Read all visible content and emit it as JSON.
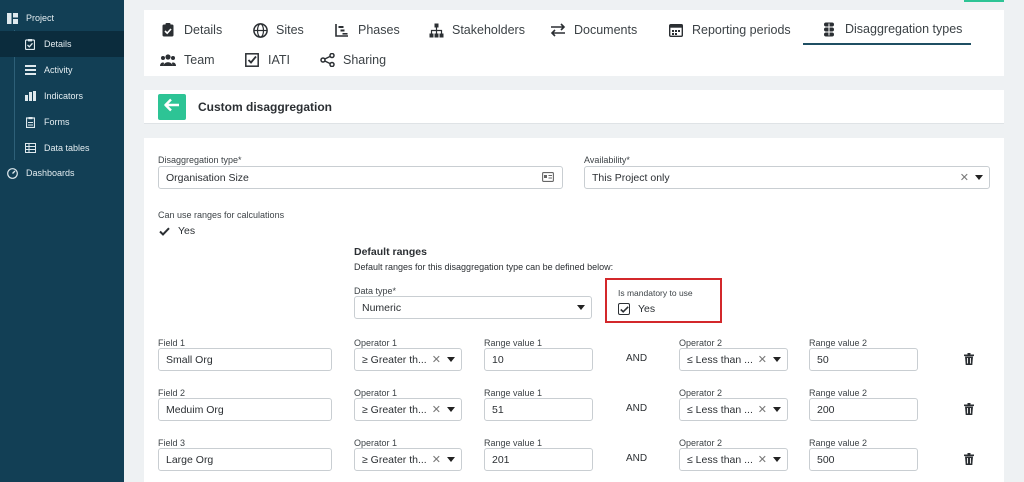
{
  "sidebar": {
    "items": [
      {
        "label": "Project",
        "icon": "project-icon",
        "level": "top",
        "active": false
      },
      {
        "label": "Details",
        "icon": "clipboard-icon",
        "level": "sub",
        "active": true
      },
      {
        "label": "Activity",
        "icon": "list-icon",
        "level": "sub",
        "active": false
      },
      {
        "label": "Indicators",
        "icon": "bar-chart-icon",
        "level": "sub",
        "active": false
      },
      {
        "label": "Forms",
        "icon": "form-icon",
        "level": "sub",
        "active": false
      },
      {
        "label": "Data tables",
        "icon": "table-icon",
        "level": "sub",
        "active": false
      },
      {
        "label": "Dashboards",
        "icon": "gauge-icon",
        "level": "top",
        "active": false
      }
    ]
  },
  "tabs": [
    {
      "label": "Details",
      "icon": "clipboard-icon",
      "active": false
    },
    {
      "label": "Sites",
      "icon": "globe-icon",
      "active": false
    },
    {
      "label": "Phases",
      "icon": "chart-icon",
      "active": false
    },
    {
      "label": "Stakeholders",
      "icon": "hierarchy-icon",
      "active": false
    },
    {
      "label": "Documents",
      "icon": "swap-icon",
      "active": false
    },
    {
      "label": "Reporting periods",
      "icon": "calendar-icon",
      "active": false
    },
    {
      "label": "Disaggregation types",
      "icon": "layers-icon",
      "active": true
    },
    {
      "label": "Team",
      "icon": "users-icon",
      "active": false
    },
    {
      "label": "IATI",
      "icon": "checkbox-icon",
      "active": false
    },
    {
      "label": "Sharing",
      "icon": "share-icon",
      "active": false
    }
  ],
  "header": {
    "title": "Custom disaggregation",
    "back_icon": "arrow-left-icon"
  },
  "form": {
    "disaggregation_type": {
      "label": "Disaggregation type*",
      "value": "Organisation Size"
    },
    "availability": {
      "label": "Availability*",
      "value": "This Project only"
    },
    "ranges": {
      "label": "Can use ranges for calculations",
      "value": "Yes"
    },
    "default_ranges": {
      "title": "Default ranges",
      "description": "Default ranges for this disaggregation type can be defined below:"
    },
    "data_type": {
      "label": "Data type*",
      "value": "Numeric"
    },
    "mandatory": {
      "label": "Is mandatory to use",
      "value": "Yes"
    },
    "and_label": "AND",
    "rows": [
      {
        "field_label": "Field 1",
        "field_value": "Small Org",
        "op1_label": "Operator 1",
        "op1_value": "≥ Greater th...",
        "rv1_label": "Range value 1",
        "rv1_value": "10",
        "op2_label": "Operator 2",
        "op2_value": "≤ Less than ...",
        "rv2_label": "Range value 2",
        "rv2_value": "50"
      },
      {
        "field_label": "Field 2",
        "field_value": "Meduim Org",
        "op1_label": "Operator 1",
        "op1_value": "≥ Greater th...",
        "rv1_label": "Range value 1",
        "rv1_value": "51",
        "op2_label": "Operator 2",
        "op2_value": "≤ Less than ...",
        "rv2_label": "Range value 2",
        "rv2_value": "200"
      },
      {
        "field_label": "Field 3",
        "field_value": "Large Org",
        "op1_label": "Operator 1",
        "op1_value": "≥ Greater th...",
        "rv1_label": "Range value 1",
        "rv1_value": "201",
        "op2_label": "Operator 2",
        "op2_value": "≤ Less than ...",
        "rv2_label": "Range value 2",
        "rv2_value": "500"
      }
    ]
  },
  "colors": {
    "sidebar": "#123f55",
    "accent": "#2dc495",
    "highlight": "#d3282b",
    "active_tab_underline": "#1f4f63"
  }
}
